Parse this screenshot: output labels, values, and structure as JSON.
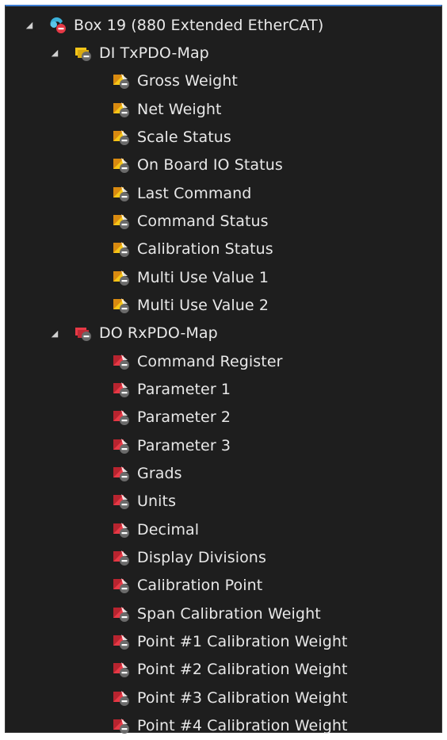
{
  "colors": {
    "background": "#1e1e1e",
    "text": "#e8e8e8",
    "input_icon": "#f5c518",
    "output_icon": "#e63946",
    "box_icon": "#3bb0d9",
    "selection_line": "#3b7bd1"
  },
  "tree": {
    "root": {
      "label": "Box 19 (880 Extended EtherCAT)",
      "icon": "ethercat-box-icon",
      "expanded": true
    },
    "inputs_group": {
      "label": "DI TxPDO-Map",
      "icon": "input-pdo-map-icon",
      "expanded": true,
      "items": [
        "Gross Weight",
        "Net Weight",
        "Scale Status",
        "On Board IO Status",
        "Last Command",
        "Command Status",
        "Calibration Status",
        "Multi Use Value 1",
        "Multi Use Value 2"
      ]
    },
    "outputs_group": {
      "label": "DO RxPDO-Map",
      "icon": "output-pdo-map-icon",
      "expanded": true,
      "items": [
        "Command Register",
        "Parameter 1",
        "Parameter 2",
        "Parameter 3",
        "Grads",
        "Units",
        "Decimal",
        "Display Divisions",
        "Calibration Point",
        "Span Calibration Weight",
        "Point #1 Calibration Weight",
        "Point #2 Calibration Weight",
        "Point #3 Calibration Weight",
        "Point #4 Calibration Weight"
      ]
    }
  }
}
